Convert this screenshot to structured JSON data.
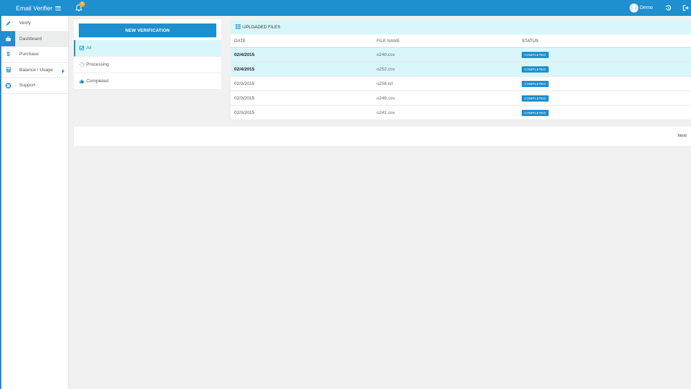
{
  "app": {
    "title": "Email Verifier"
  },
  "topbar": {
    "notification_count": "5",
    "user_name": "Demo"
  },
  "sidebar": {
    "items": [
      {
        "label": "Verify",
        "icon": "pencil-icon"
      },
      {
        "label": "Dashboard",
        "icon": "briefcase-icon",
        "active": true
      },
      {
        "label": "Purchase",
        "icon": "dollar-icon"
      },
      {
        "label": "Balance / Usage",
        "icon": "calculator-icon"
      },
      {
        "label": "Support",
        "icon": "lifebuoy-icon"
      }
    ]
  },
  "verification": {
    "new_button_label": "NEW VERIFICATION",
    "filters": [
      {
        "label": "All",
        "icon": "checkbox-icon"
      },
      {
        "label": "Processing",
        "icon": "spinner-icon"
      },
      {
        "label": "Completed",
        "icon": "thumbs-up-icon"
      }
    ]
  },
  "files": {
    "title": "UPLOADED FILES",
    "columns": [
      "DATE",
      "FILE NAME",
      "STATUS"
    ],
    "rows": [
      {
        "date": "02/4/2015",
        "file": "o240.csv",
        "status": "COMPLETED"
      },
      {
        "date": "02/4/2015",
        "file": "o252.csv",
        "status": "COMPLETED"
      },
      {
        "date": "02/3/2015",
        "file": "o258.txt",
        "status": "COMPLETED"
      },
      {
        "date": "02/3/2015",
        "file": "o249.csv",
        "status": "COMPLETED"
      },
      {
        "date": "02/3/2015",
        "file": "o241.csv",
        "status": "COMPLETED"
      }
    ]
  },
  "pager": {
    "next_label": "Next"
  },
  "colors": {
    "accent": "#1e8fcf",
    "highlight": "#d9f7fb",
    "badge": "#f5a623"
  }
}
